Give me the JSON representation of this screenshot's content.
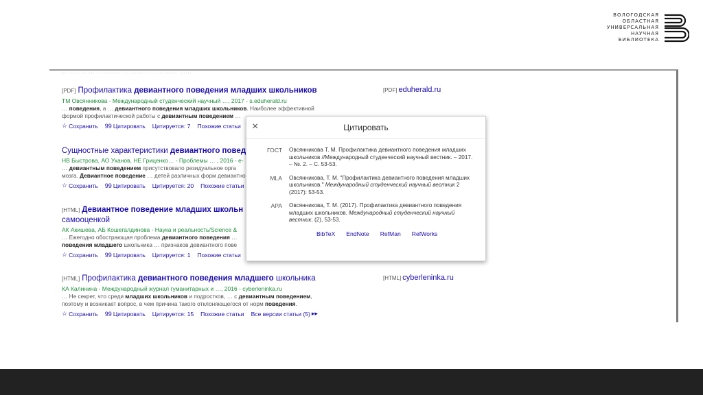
{
  "logo": {
    "lines": [
      "ВОЛОГОДСКАЯ",
      "ОБЛАСТНАЯ",
      "УНИВЕРСАЛЬНАЯ",
      "НАУЧНАЯ",
      "БИБЛИОТЕКА"
    ]
  },
  "results": [
    {
      "tag": "[PDF]",
      "title_pre": "Профилактика ",
      "title_bold": "девиантного поведения младших школьников",
      "title_post": "",
      "meta": "ТМ Овсянникова - Международный студенческий научный …, 2017 - s.eduherald.ru",
      "snippet1_pre": "… ",
      "snippet1_bold": "поведения",
      "snippet1_mid": ", а … ",
      "snippet1_bold2": "девиантного поведения младших школьников",
      "snippet1_post": ". Наиболее эффективной",
      "snippet2_pre": "формой профилактической работы с ",
      "snippet2_bold": "девиантным поведением",
      "snippet2_post": " …",
      "actions": [
        "Сохранить",
        "Цитировать",
        "Цитируется: 7",
        "Похожие статьи"
      ],
      "side_tag": "[PDF]",
      "side_link": "eduherald.ru"
    },
    {
      "tag": "",
      "title_pre": "Сущностные характеристики ",
      "title_bold": "девиантного поведения",
      "title_post": "",
      "meta": "НВ Быстрова, АО Уханов, НЕ Гриценко… - Проблемы … , 2016 - e-",
      "snippet1_pre": "… ",
      "snippet1_bold": "девиантным поведением",
      "snippet1_mid": " присутствовало резидуальное орга",
      "snippet1_bold2": "",
      "snippet1_post": "",
      "snippet2_pre": "мозга. ",
      "snippet2_bold": "Девиантное поведение",
      "snippet2_post": " … детей различных форм девиантного",
      "actions": [
        "Сохранить",
        "Цитировать",
        "Цитируется: 20",
        "Похожие статьи"
      ],
      "side_tag": "",
      "side_link": ""
    },
    {
      "tag": "[HTML]",
      "title_pre": "",
      "title_bold": "Девиантное поведение младших школьн",
      "title_post": "",
      "title2": "самооценкой",
      "meta": "АК Акишева, АБ Кошегалдинова - Наука и реальность/Science & ",
      "snippet1_pre": "… Ежегодно обострающая проблема ",
      "snippet1_bold": "девиантного поведения",
      "snippet1_mid": " …",
      "snippet1_bold2": "",
      "snippet1_post": "",
      "snippet2_pre": "",
      "snippet2_bold": "поведения младшего",
      "snippet2_post": " школьника … признаков девиантного пове",
      "actions": [
        "Сохранить",
        "Цитировать",
        "Цитируется: 1",
        "Похожие статьи"
      ],
      "side_tag": "",
      "side_link": ""
    },
    {
      "tag": "[HTML]",
      "title_pre": "Профилактика ",
      "title_bold": "девиантного поведения младшего",
      "title_post": " школьника",
      "meta": "КА Калинина - Международный журнал гуманитарных и …, 2016 - cyberleninka.ru",
      "snippet1_pre": "… Не секрет, что среди ",
      "snippet1_bold": "младших школьников",
      "snippet1_mid": " и подростков, … с ",
      "snippet1_bold2": "девиантным поведением",
      "snippet1_post": ",",
      "snippet2_pre": "поэтому и возникает вопрос, в чем причина такого отклоняющегося от норм ",
      "snippet2_bold": "поведения",
      "snippet2_post": ".",
      "actions": [
        "Сохранить",
        "Цитировать",
        "Цитируется: 15",
        "Похожие статьи",
        "Все версии статьи (5)"
      ],
      "side_tag": "[HTML]",
      "side_link": "cyberleninka.ru"
    }
  ],
  "cite_dialog": {
    "close": "×",
    "title": "Цитировать",
    "entries": [
      {
        "label": "ГОСТ",
        "text": "Овсянникова Т. М. Профилактика девиантного поведения младших школьников //Международный студенческий научный вестник. – 2017. – №. 2. – С. 53-53.",
        "italic": ""
      },
      {
        "label": "MLA",
        "text": "Овсянникова, Т. М. \"Профилактика девиантного поведения младших школьников.\" ",
        "italic": "Международный студенческий научный вестник",
        "tail": " 2 (2017): 53-53."
      },
      {
        "label": "APA",
        "text": "Овсянникова, Т. М. (2017). Профилактика девиантного поведения младших школьников. ",
        "italic": "Международный студенческий научный вестник",
        "tail": ", (2), 53-53."
      }
    ],
    "links": [
      "BibTeX",
      "EndNote",
      "RefMan",
      "RefWorks"
    ]
  }
}
